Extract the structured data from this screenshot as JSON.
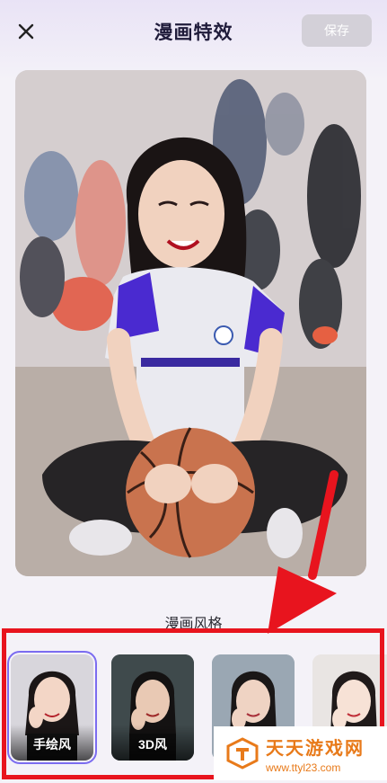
{
  "header": {
    "title": "漫画特效",
    "save_label": "保存",
    "close_icon": "close-icon"
  },
  "section": {
    "title": "漫画风格"
  },
  "styles": [
    {
      "label": "手绘风",
      "selected": true
    },
    {
      "label": "3D风",
      "selected": false
    },
    {
      "label": "",
      "selected": false
    },
    {
      "label": "",
      "selected": false
    }
  ],
  "watermark": {
    "name": "天天游戏网",
    "url": "www.ttyl23.com"
  },
  "colors": {
    "accent": "#7b6cf0",
    "highlight": "#e8141e",
    "save_disabled": "#d3d0d8",
    "watermark": "#e87a1a"
  }
}
